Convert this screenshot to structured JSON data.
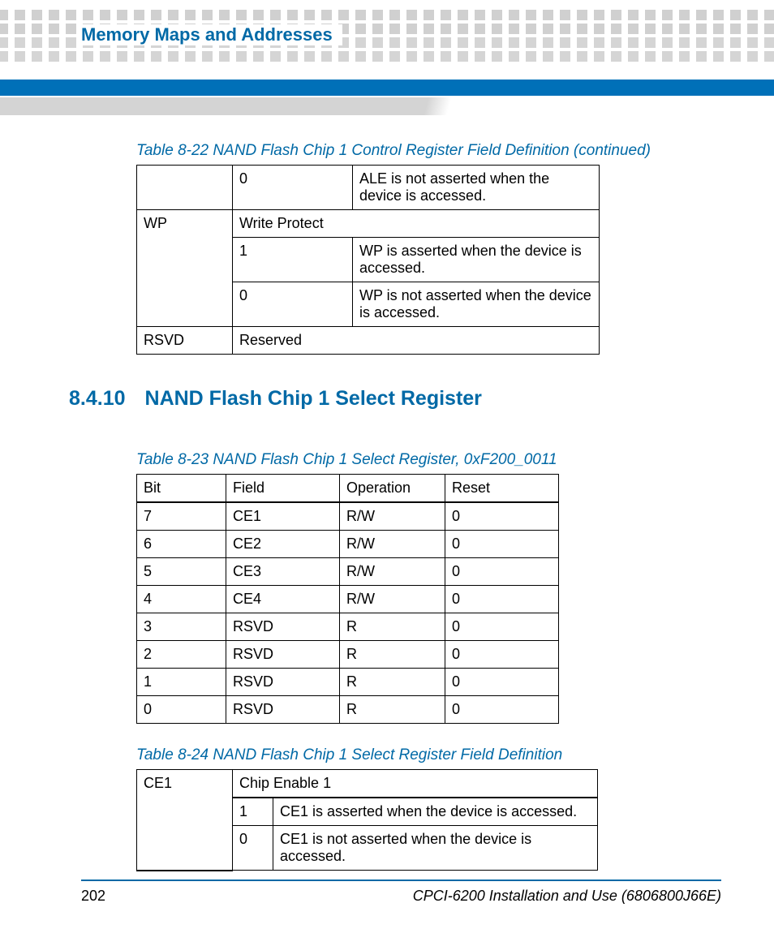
{
  "header": {
    "title": "Memory Maps and Addresses"
  },
  "table22": {
    "caption": "Table 8-22 NAND Flash Chip 1 Control Register Field Definition (continued)",
    "r1c2": "0",
    "r1c3": "ALE is not asserted when the device is accessed.",
    "r2c1": "WP",
    "r2c2": "Write Protect",
    "r3c2": "1",
    "r3c3": "WP is asserted when the device is accessed.",
    "r4c2": "0",
    "r4c3": "WP is not asserted when the device is accessed.",
    "r5c1": "RSVD",
    "r5c2": "Reserved"
  },
  "section": {
    "num": "8.4.10",
    "title": "NAND Flash Chip 1 Select Register"
  },
  "table23": {
    "caption": "Table 8-23 NAND Flash Chip 1 Select Register, 0xF200_0011",
    "head": {
      "c1": "Bit",
      "c2": "Field",
      "c3": "Operation",
      "c4": "Reset"
    },
    "rows": [
      {
        "c1": "7",
        "c2": "CE1",
        "c3": "R/W",
        "c4": "0"
      },
      {
        "c1": "6",
        "c2": "CE2",
        "c3": "R/W",
        "c4": "0"
      },
      {
        "c1": "5",
        "c2": "CE3",
        "c3": "R/W",
        "c4": "0"
      },
      {
        "c1": "4",
        "c2": "CE4",
        "c3": "R/W",
        "c4": "0"
      },
      {
        "c1": "3",
        "c2": "RSVD",
        "c3": "R",
        "c4": "0"
      },
      {
        "c1": "2",
        "c2": "RSVD",
        "c3": "R",
        "c4": "0"
      },
      {
        "c1": "1",
        "c2": "RSVD",
        "c3": "R",
        "c4": "0"
      },
      {
        "c1": "0",
        "c2": "RSVD",
        "c3": "R",
        "c4": "0"
      }
    ]
  },
  "table24": {
    "caption": "Table 8-24 NAND Flash Chip 1 Select Register Field Definition",
    "r1c1": "CE1",
    "r1c2": "Chip Enable 1",
    "r2c2": "1",
    "r2c3": "CE1 is asserted when the device is accessed.",
    "r3c2": "0",
    "r3c3": "CE1 is not asserted when the device is accessed."
  },
  "footer": {
    "page": "202",
    "doc": "CPCI-6200 Installation and Use (6806800J66E)"
  }
}
